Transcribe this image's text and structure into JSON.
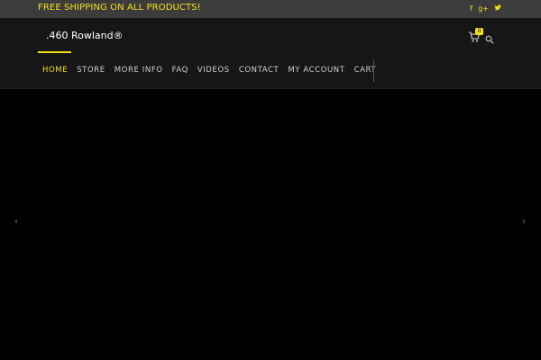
{
  "topbar": {
    "promo_text": "FREE SHIPPING ON ALL PRODUCTS!",
    "social": [
      {
        "name": "facebook-icon",
        "glyph": "f"
      },
      {
        "name": "google-plus-icon",
        "glyph": "g+"
      },
      {
        "name": "twitter-icon",
        "glyph": "ᵛ"
      }
    ]
  },
  "header": {
    "logo_text": ".460 Rowland®",
    "cart_count": "0"
  },
  "nav": {
    "items": [
      {
        "label": "HOME",
        "active": true
      },
      {
        "label": "STORE"
      },
      {
        "label": "MORE INFO"
      },
      {
        "label": "FAQ"
      },
      {
        "label": "VIDEOS"
      },
      {
        "label": "CONTACT"
      },
      {
        "label": "MY ACCOUNT"
      },
      {
        "label": "CART"
      }
    ]
  },
  "slider": {
    "prev_glyph": "‹",
    "next_glyph": "›"
  },
  "colors": {
    "accent": "#f3e012",
    "topbar_bg": "#3c3c3c",
    "header_bg": "#161616",
    "page_bg": "#000000",
    "nav_text": "#cfcfcf"
  }
}
